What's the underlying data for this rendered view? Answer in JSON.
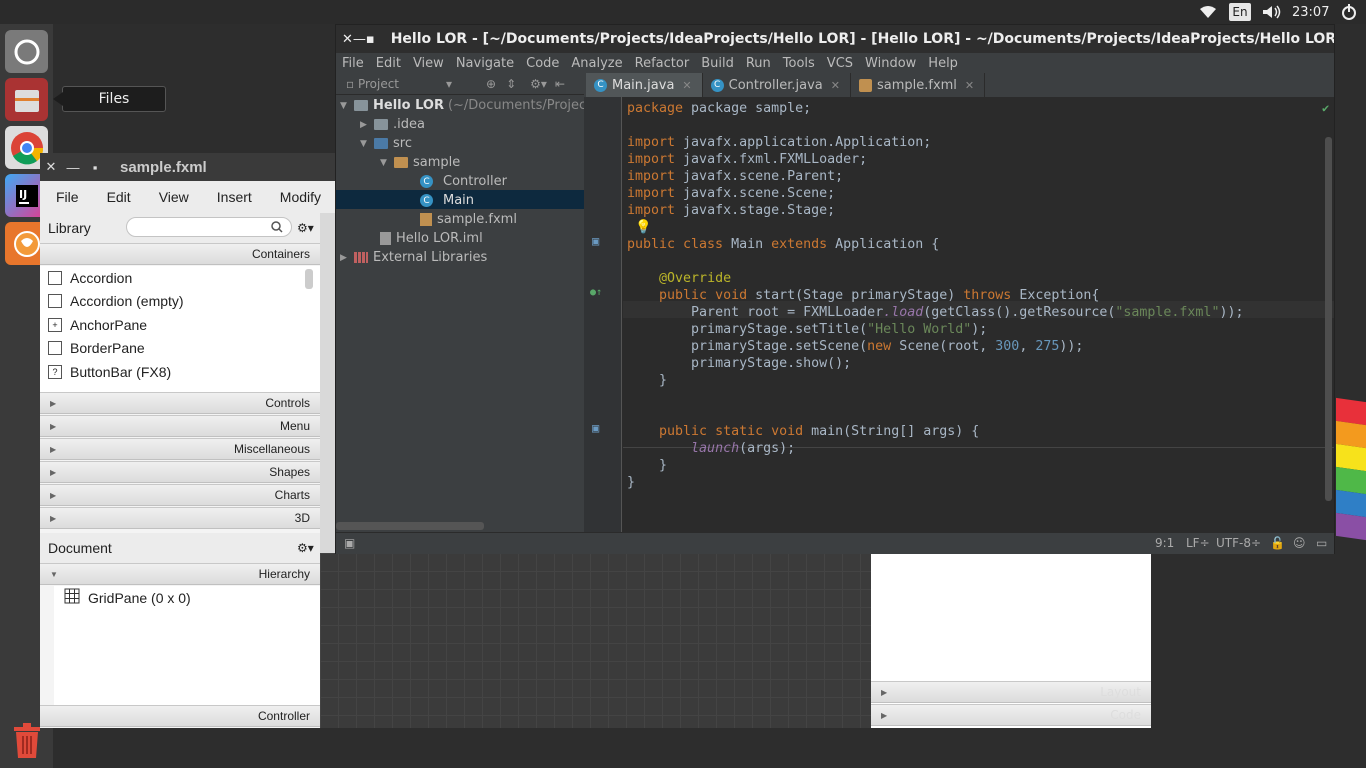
{
  "top_panel": {
    "language": "En",
    "clock": "23:07"
  },
  "launcher": {
    "tooltip": "Files",
    "items": [
      "ubuntu-logo-icon",
      "files-icon",
      "chrome-icon",
      "intellij-icon",
      "scene-builder-icon"
    ],
    "trash": "trash-icon"
  },
  "scene_builder": {
    "title": "sample.fxml",
    "menu": [
      "File",
      "Edit",
      "View",
      "Insert",
      "Modify"
    ],
    "library_label": "Library",
    "containers_label": "Containers",
    "library_items": [
      "Accordion",
      "Accordion  (empty)",
      "AnchorPane",
      "BorderPane",
      "ButtonBar  (FX8)"
    ],
    "sections": [
      "Controls",
      "Menu",
      "Miscellaneous",
      "Shapes",
      "Charts",
      "3D"
    ],
    "document_label": "Document",
    "hierarchy_label": "Hierarchy",
    "hierarchy_item": "GridPane (0 x 0)",
    "controller_label": "Controller",
    "right_sections": [
      "Layout",
      "Code"
    ]
  },
  "ide": {
    "title": "Hello LOR - [~/Documents/Projects/IdeaProjects/Hello LOR] - [Hello LOR] - ~/Documents/Projects/IdeaProjects/Hello LOR/src",
    "menu": [
      "File",
      "Edit",
      "View",
      "Navigate",
      "Code",
      "Analyze",
      "Refactor",
      "Build",
      "Run",
      "Tools",
      "VCS",
      "Window",
      "Help"
    ],
    "project_dropdown": "Project",
    "tabs": [
      {
        "label": "Main.java",
        "active": true
      },
      {
        "label": "Controller.java",
        "active": false
      },
      {
        "label": "sample.fxml",
        "active": false
      }
    ],
    "tree": {
      "root": "Hello LOR",
      "root_path": "(~/Documents/Project",
      "idea": ".idea",
      "src": "src",
      "sample": "sample",
      "controller": "Controller",
      "main": "Main",
      "fxml": "sample.fxml",
      "iml": "Hello LOR.iml",
      "libraries": "External Libraries"
    },
    "code": {
      "l1": "package sample;",
      "imp1": "javafx.application.Application;",
      "imp2": "javafx.fxml.FXMLLoader;",
      "imp3": "javafx.scene.Parent;",
      "imp4": "javafx.scene.Scene;",
      "imp5": "javafx.stage.Stage;",
      "class_name": "Main",
      "super_name": "Application",
      "override": "@Override",
      "start_sig": "start(",
      "start_param": "Stage",
      "start_rest": " primaryStage) ",
      "exception": "Exception{",
      "root_type": "Parent",
      "root_rest": " root = ",
      "loader": "FXMLLoader",
      "load": ".load",
      "getres": "(getClass().getResource(",
      "fxml_str": "\"sample.fxml\"",
      "close2": "));",
      "title_call": "primaryStage.setTitle(",
      "title_str": "\"Hello World\"",
      "close1": ");",
      "scene_call": "primaryStage.setScene(",
      "scene_new": "new",
      "scene_rest": " Scene(root, ",
      "w": "300",
      "h": "275",
      "show_call": "primaryStage.show();",
      "main_sig": "main(",
      "main_param": "String",
      "main_rest": "[] args) {",
      "launch": "launch",
      "launch_rest": "(args);"
    },
    "status": {
      "position": "9:1",
      "line_sep": "LF÷",
      "encoding": "UTF-8÷"
    }
  }
}
